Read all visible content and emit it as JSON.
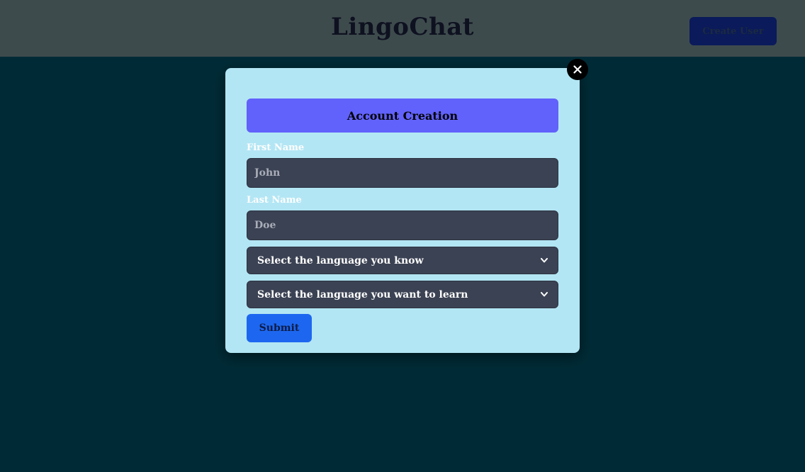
{
  "header": {
    "title": "LingoChat",
    "create_user_label": "Create User"
  },
  "modal": {
    "heading": "Account Creation",
    "close_icon": "close-icon",
    "first_name": {
      "label": "First Name",
      "placeholder": "John",
      "value": ""
    },
    "last_name": {
      "label": "Last Name",
      "placeholder": "Doe",
      "value": ""
    },
    "known_language": {
      "selected": "Select the language you know"
    },
    "learn_language": {
      "selected": "Select the language you want to learn"
    },
    "submit_label": "Submit"
  },
  "colors": {
    "page_background": "#002b36",
    "header_background": "#3e4b4d",
    "modal_background": "#b3e6f4",
    "heading_background": "#6161fb",
    "input_background": "#3b4253",
    "submit_background": "#1d67f0",
    "create_user_background": "#0a1a5a"
  }
}
